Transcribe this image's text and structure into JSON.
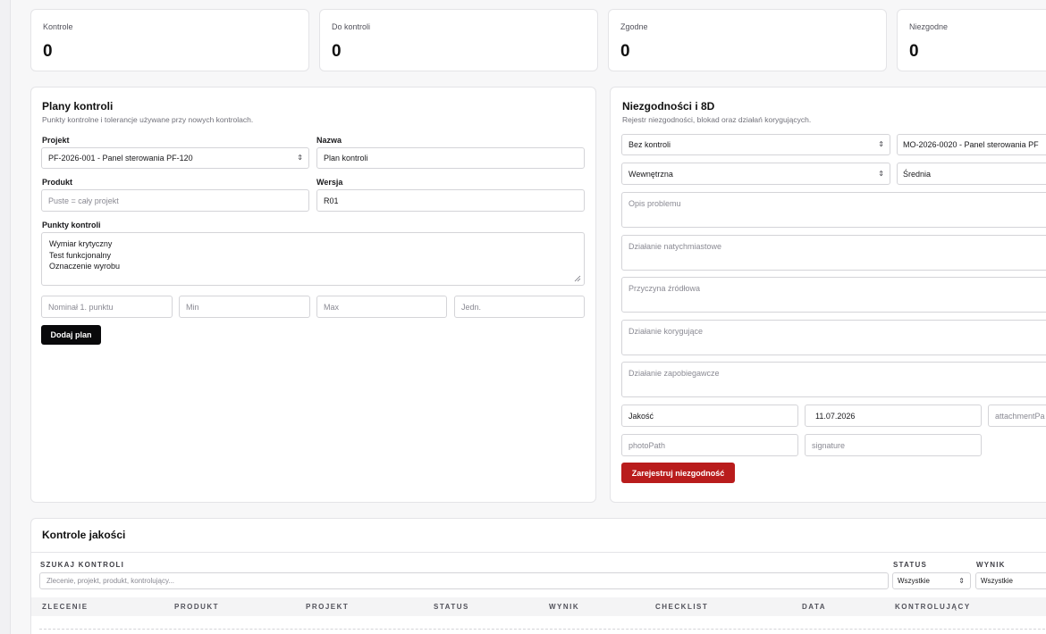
{
  "stats": [
    {
      "label": "Kontrole",
      "value": "0"
    },
    {
      "label": "Do kontroli",
      "value": "0"
    },
    {
      "label": "Zgodne",
      "value": "0"
    },
    {
      "label": "Niezgodne",
      "value": "0"
    }
  ],
  "plans": {
    "title": "Plany kontroli",
    "subtitle": "Punkty kontrolne i tolerancje używane przy nowych kontrolach.",
    "project_label": "Projekt",
    "project_value": "PF-2026-001 - Panel sterowania PF-120",
    "name_label": "Nazwa",
    "name_value": "Plan kontroli",
    "product_label": "Produkt",
    "product_placeholder": "Puste = cały projekt",
    "version_label": "Wersja",
    "version_value": "R01",
    "points_label": "Punkty kontroli",
    "points_lines": [
      "Wymiar krytyczny",
      "Test funkcjonalny",
      "Oznaczenie wyrobu"
    ],
    "nominal_placeholder": "Nominał 1. punktu",
    "min_placeholder": "Min",
    "max_placeholder": "Max",
    "unit_placeholder": "Jedn.",
    "add_button": "Dodaj plan"
  },
  "nc": {
    "title": "Niezgodności i 8D",
    "subtitle": "Rejestr niezgodności, blokad oraz działań korygujących.",
    "inspection_select": "Bez kontroli",
    "order_select": "MO-2026-0020 - Panel sterowania PF",
    "type_select": "Wewnętrzna",
    "severity_select": "Średnia",
    "problem_placeholder": "Opis problemu",
    "immediate_placeholder": "Działanie natychmiastowe",
    "root_cause_placeholder": "Przyczyna źródłowa",
    "corrective_placeholder": "Działanie korygujące",
    "preventive_placeholder": "Działanie zapobiegawcze",
    "owner_value": "Jakość",
    "date_value": "11.07.2026",
    "attachment_placeholder": "attachmentPa",
    "photo_placeholder": "photoPath",
    "signature_placeholder": "signature",
    "register_button": "Zarejestruj niezgodność"
  },
  "inspections": {
    "title": "Kontrole jakości",
    "search_label": "SZUKAJ KONTROLI",
    "search_placeholder": "Zlecenie, projekt, produkt, kontrolujący...",
    "status_label": "STATUS",
    "status_value": "Wszystkie",
    "result_label": "WYNIK",
    "result_value": "Wszystkie",
    "columns": [
      "ZLECENIE",
      "PRODUKT",
      "PROJEKT",
      "STATUS",
      "WYNIK",
      "CHECKLIST",
      "DATA",
      "KONTROLUJĄCY"
    ]
  }
}
